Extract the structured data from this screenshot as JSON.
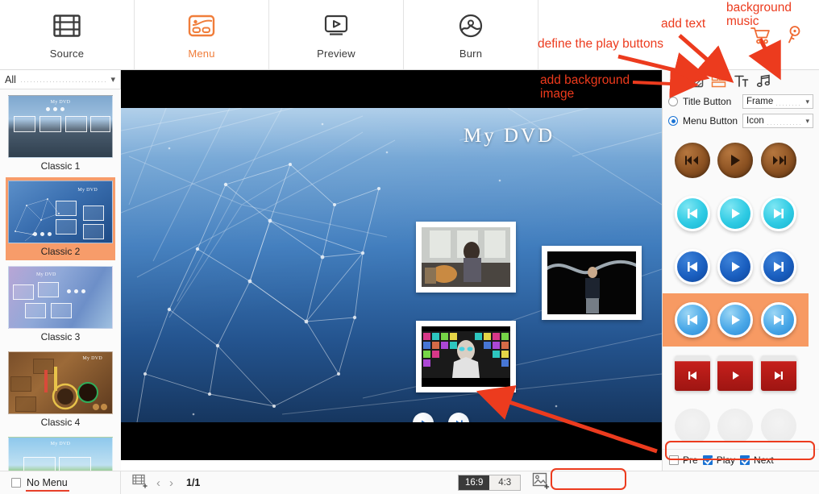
{
  "app": {
    "aspect_selected": "16:9",
    "accent_orange": "#f07d3a",
    "accent_blue": "#1a73d4",
    "annotation_red": "#ec3b1e"
  },
  "toolbar": {
    "tabs": [
      {
        "label": "Source",
        "icon": "film-strip-icon",
        "active": false
      },
      {
        "label": "Menu",
        "icon": "menu-template-icon",
        "active": true
      },
      {
        "label": "Preview",
        "icon": "monitor-play-icon",
        "active": false
      },
      {
        "label": "Burn",
        "icon": "burn-disc-icon",
        "active": false
      }
    ],
    "cart_icon": "shopping-cart-icon",
    "key_icon": "key-icon"
  },
  "sidebar": {
    "filter": {
      "value": "All",
      "placeholder": "All"
    },
    "templates": [
      {
        "name": "Classic 1",
        "selected": false,
        "title": "My DVD"
      },
      {
        "name": "Classic 2",
        "selected": true,
        "title": "My DVD"
      },
      {
        "name": "Classic 3",
        "selected": false,
        "title": "My DVD"
      },
      {
        "name": "Classic 4",
        "selected": false,
        "title": "My DVD"
      },
      {
        "name": "",
        "selected": false,
        "title": "My DVD"
      }
    ],
    "no_menu": {
      "label": "No Menu",
      "checked": false
    }
  },
  "preview": {
    "menu_title": "My DVD",
    "thumbnails": [
      {
        "name": "video-thumb-1"
      },
      {
        "name": "video-thumb-2"
      },
      {
        "name": "video-thumb-3"
      }
    ],
    "buttons": [
      {
        "name": "preview-play-button",
        "glyph": "play"
      },
      {
        "name": "preview-next-button",
        "glyph": "next"
      }
    ]
  },
  "right_panel": {
    "tool_icons": [
      {
        "name": "collapse-panel-icon",
        "glyph": "chevron-right"
      },
      {
        "name": "background-image-icon",
        "glyph": "image-hatch"
      },
      {
        "name": "play-buttons-icon",
        "glyph": "frames",
        "active": true
      },
      {
        "name": "add-text-icon",
        "glyph": "TT"
      },
      {
        "name": "background-music-icon",
        "glyph": "music-note"
      }
    ],
    "title_button": {
      "label": "Title Button",
      "selected": false,
      "dropdown": "Frame"
    },
    "menu_button": {
      "label": "Menu Button",
      "selected": true,
      "dropdown": "Icon"
    },
    "button_styles": [
      {
        "name": "wood-buttons",
        "style": "wood",
        "selected": false
      },
      {
        "name": "cyan-buttons",
        "style": "cyan",
        "selected": false
      },
      {
        "name": "navy-buttons",
        "style": "navy",
        "selected": false
      },
      {
        "name": "lightblue-buttons",
        "style": "lblue",
        "selected": true
      },
      {
        "name": "red-buttons",
        "style": "red",
        "selected": false
      },
      {
        "name": "ghost-buttons",
        "style": "ghost",
        "selected": false
      }
    ],
    "visibility": [
      {
        "label": "Pre",
        "checked": false
      },
      {
        "label": "Play",
        "checked": true
      },
      {
        "label": "Next",
        "checked": true
      }
    ]
  },
  "bottom_bar": {
    "add_chapter_icon": "add-film-icon",
    "prev_label": "‹",
    "next_label": "›",
    "page_indicator": "1/1",
    "ratios": [
      {
        "label": "16:9",
        "selected": true
      },
      {
        "label": "4:3",
        "selected": false
      }
    ],
    "add_image_icon": "add-image-icon"
  },
  "annotations": [
    {
      "id": "define-play-buttons",
      "text": "define the play buttons"
    },
    {
      "id": "add-text",
      "text": "add text"
    },
    {
      "id": "background-music",
      "text": "background\nmusic"
    },
    {
      "id": "add-background-image",
      "text": "add background\nimage"
    }
  ]
}
